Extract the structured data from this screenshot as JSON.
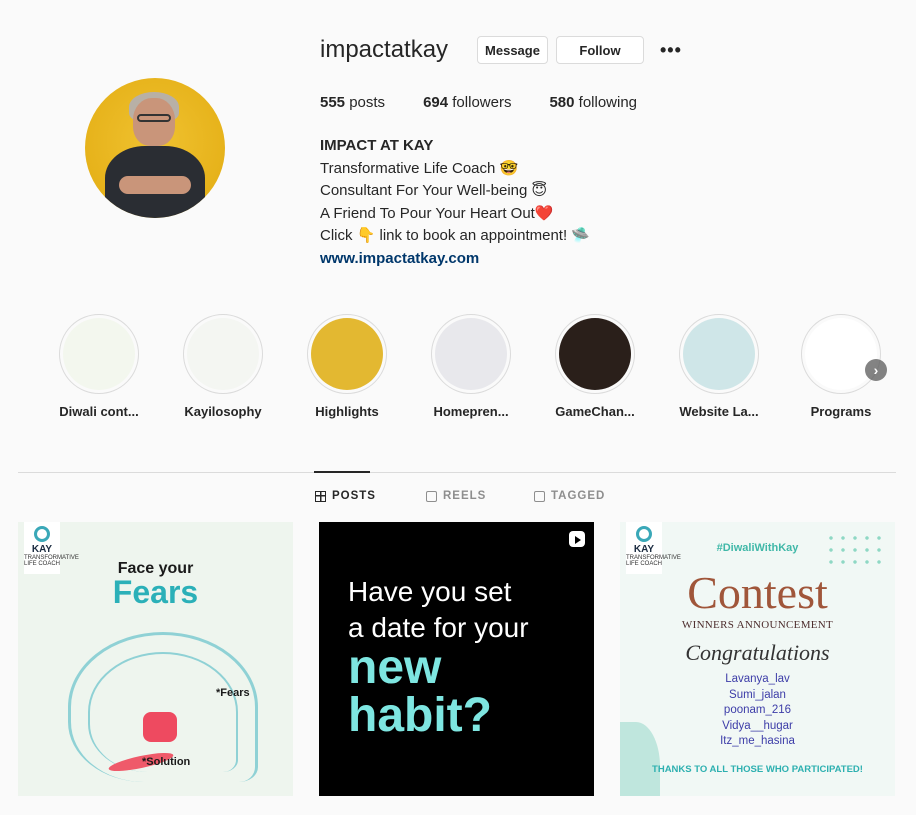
{
  "profile": {
    "username": "impactatkay",
    "message_label": "Message",
    "follow_label": "Follow",
    "more_label": "•••",
    "stats": {
      "posts_count": "555",
      "posts_label": "posts",
      "followers_count": "694",
      "followers_label": "followers",
      "following_count": "580",
      "following_label": "following"
    },
    "bio": {
      "name": "IMPACT AT KAY",
      "line1": "Transformative Life Coach 🤓",
      "line2": "Consultant For Your Well-being 😇",
      "line3": "A Friend To Pour Your Heart Out❤️",
      "line4": "Click 👇 link to book an appointment! 🛸",
      "link": "www.impactatkay.com"
    }
  },
  "highlights": [
    {
      "label": "Diwali cont...",
      "bg": "#f3f7ee"
    },
    {
      "label": "Kayilosophy",
      "bg": "#f4f6f2"
    },
    {
      "label": "Highlights",
      "bg": "#e3b831"
    },
    {
      "label": "Homepren...",
      "bg": "#e8e8ec"
    },
    {
      "label": "GameChan...",
      "bg": "#2a1f1a"
    },
    {
      "label": "Website La...",
      "bg": "#cfe6e8"
    },
    {
      "label": "Programs",
      "bg": "#ffffff"
    }
  ],
  "highlights_next_icon": "chevron-right-icon",
  "tabs": {
    "posts": "POSTS",
    "reels": "REELS",
    "tagged": "TAGGED"
  },
  "posts": {
    "p1": {
      "logo_name": "KAY",
      "logo_sub": "TRANSFORMATIVE LIFE COACH",
      "title1": "Face your",
      "title2": "Fears",
      "fears_label": "*Fears",
      "solution_label": "*Solution"
    },
    "p2": {
      "line1": "Have you set",
      "line2": "a date for your",
      "line3": "new",
      "line4": "habit?"
    },
    "p3": {
      "logo_name": "KAY",
      "logo_sub": "TRANSFORMATIVE LIFE COACH",
      "hashtag": "#DiwaliWithKay",
      "contest": "Contest",
      "winners": "WINNERS ANNOUNCEMENT",
      "congrats": "Congratulations",
      "names": [
        "Lavanya_lav",
        "Sumi_jalan",
        "poonam_216",
        "Vidya__hugar",
        "Itz_me_hasina"
      ],
      "thanks": "THANKS TO ALL THOSE WHO PARTICIPATED!"
    }
  }
}
